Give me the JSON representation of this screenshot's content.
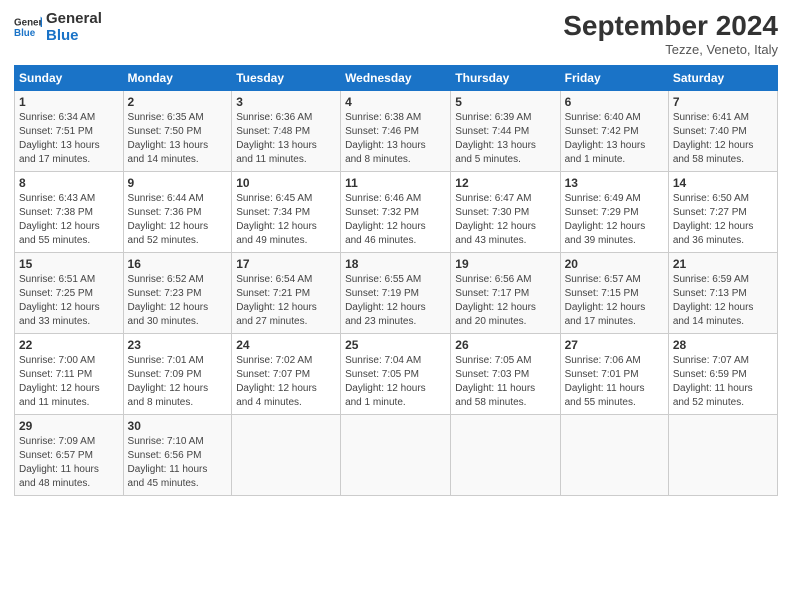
{
  "header": {
    "logo_line1": "General",
    "logo_line2": "Blue",
    "month_title": "September 2024",
    "location": "Tezze, Veneto, Italy"
  },
  "columns": [
    "Sunday",
    "Monday",
    "Tuesday",
    "Wednesday",
    "Thursday",
    "Friday",
    "Saturday"
  ],
  "weeks": [
    [
      {
        "day": "1",
        "text": "Sunrise: 6:34 AM\nSunset: 7:51 PM\nDaylight: 13 hours\nand 17 minutes."
      },
      {
        "day": "2",
        "text": "Sunrise: 6:35 AM\nSunset: 7:50 PM\nDaylight: 13 hours\nand 14 minutes."
      },
      {
        "day": "3",
        "text": "Sunrise: 6:36 AM\nSunset: 7:48 PM\nDaylight: 13 hours\nand 11 minutes."
      },
      {
        "day": "4",
        "text": "Sunrise: 6:38 AM\nSunset: 7:46 PM\nDaylight: 13 hours\nand 8 minutes."
      },
      {
        "day": "5",
        "text": "Sunrise: 6:39 AM\nSunset: 7:44 PM\nDaylight: 13 hours\nand 5 minutes."
      },
      {
        "day": "6",
        "text": "Sunrise: 6:40 AM\nSunset: 7:42 PM\nDaylight: 13 hours\nand 1 minute."
      },
      {
        "day": "7",
        "text": "Sunrise: 6:41 AM\nSunset: 7:40 PM\nDaylight: 12 hours\nand 58 minutes."
      }
    ],
    [
      {
        "day": "8",
        "text": "Sunrise: 6:43 AM\nSunset: 7:38 PM\nDaylight: 12 hours\nand 55 minutes."
      },
      {
        "day": "9",
        "text": "Sunrise: 6:44 AM\nSunset: 7:36 PM\nDaylight: 12 hours\nand 52 minutes."
      },
      {
        "day": "10",
        "text": "Sunrise: 6:45 AM\nSunset: 7:34 PM\nDaylight: 12 hours\nand 49 minutes."
      },
      {
        "day": "11",
        "text": "Sunrise: 6:46 AM\nSunset: 7:32 PM\nDaylight: 12 hours\nand 46 minutes."
      },
      {
        "day": "12",
        "text": "Sunrise: 6:47 AM\nSunset: 7:30 PM\nDaylight: 12 hours\nand 43 minutes."
      },
      {
        "day": "13",
        "text": "Sunrise: 6:49 AM\nSunset: 7:29 PM\nDaylight: 12 hours\nand 39 minutes."
      },
      {
        "day": "14",
        "text": "Sunrise: 6:50 AM\nSunset: 7:27 PM\nDaylight: 12 hours\nand 36 minutes."
      }
    ],
    [
      {
        "day": "15",
        "text": "Sunrise: 6:51 AM\nSunset: 7:25 PM\nDaylight: 12 hours\nand 33 minutes."
      },
      {
        "day": "16",
        "text": "Sunrise: 6:52 AM\nSunset: 7:23 PM\nDaylight: 12 hours\nand 30 minutes."
      },
      {
        "day": "17",
        "text": "Sunrise: 6:54 AM\nSunset: 7:21 PM\nDaylight: 12 hours\nand 27 minutes."
      },
      {
        "day": "18",
        "text": "Sunrise: 6:55 AM\nSunset: 7:19 PM\nDaylight: 12 hours\nand 23 minutes."
      },
      {
        "day": "19",
        "text": "Sunrise: 6:56 AM\nSunset: 7:17 PM\nDaylight: 12 hours\nand 20 minutes."
      },
      {
        "day": "20",
        "text": "Sunrise: 6:57 AM\nSunset: 7:15 PM\nDaylight: 12 hours\nand 17 minutes."
      },
      {
        "day": "21",
        "text": "Sunrise: 6:59 AM\nSunset: 7:13 PM\nDaylight: 12 hours\nand 14 minutes."
      }
    ],
    [
      {
        "day": "22",
        "text": "Sunrise: 7:00 AM\nSunset: 7:11 PM\nDaylight: 12 hours\nand 11 minutes."
      },
      {
        "day": "23",
        "text": "Sunrise: 7:01 AM\nSunset: 7:09 PM\nDaylight: 12 hours\nand 8 minutes."
      },
      {
        "day": "24",
        "text": "Sunrise: 7:02 AM\nSunset: 7:07 PM\nDaylight: 12 hours\nand 4 minutes."
      },
      {
        "day": "25",
        "text": "Sunrise: 7:04 AM\nSunset: 7:05 PM\nDaylight: 12 hours\nand 1 minute."
      },
      {
        "day": "26",
        "text": "Sunrise: 7:05 AM\nSunset: 7:03 PM\nDaylight: 11 hours\nand 58 minutes."
      },
      {
        "day": "27",
        "text": "Sunrise: 7:06 AM\nSunset: 7:01 PM\nDaylight: 11 hours\nand 55 minutes."
      },
      {
        "day": "28",
        "text": "Sunrise: 7:07 AM\nSunset: 6:59 PM\nDaylight: 11 hours\nand 52 minutes."
      }
    ],
    [
      {
        "day": "29",
        "text": "Sunrise: 7:09 AM\nSunset: 6:57 PM\nDaylight: 11 hours\nand 48 minutes."
      },
      {
        "day": "30",
        "text": "Sunrise: 7:10 AM\nSunset: 6:56 PM\nDaylight: 11 hours\nand 45 minutes."
      },
      {
        "day": "",
        "text": ""
      },
      {
        "day": "",
        "text": ""
      },
      {
        "day": "",
        "text": ""
      },
      {
        "day": "",
        "text": ""
      },
      {
        "day": "",
        "text": ""
      }
    ]
  ]
}
